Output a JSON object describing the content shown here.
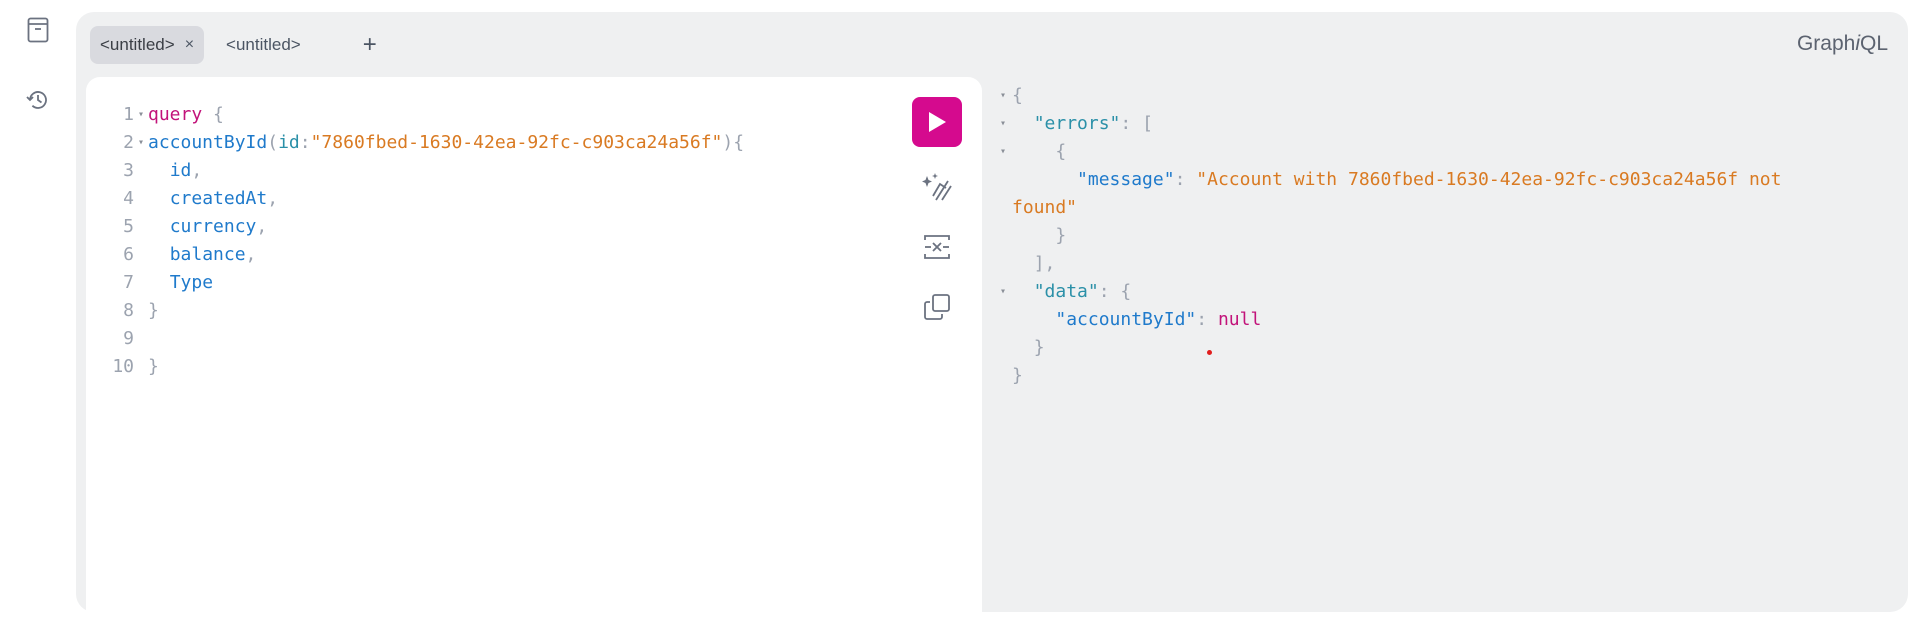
{
  "app": {
    "logo_prefix": "Graph",
    "logo_italic": "i",
    "logo_suffix": "QL"
  },
  "tabs": [
    {
      "label": "<untitled>",
      "close": "×"
    },
    {
      "label": "<untitled>"
    }
  ],
  "tab_add": "+",
  "icons": {
    "docs": "docs-icon",
    "history": "history-icon",
    "run": "play-icon",
    "prettify": "prettify-icon",
    "merge": "merge-fragments-icon",
    "copy": "copy-icon"
  },
  "colors": {
    "accent": "#d50a8e",
    "keyword": "#c2137a",
    "field": "#1f7acb",
    "string": "#d97a22",
    "key": "#2b90a8"
  },
  "query": {
    "line_numbers": [
      "1",
      "2",
      "3",
      "4",
      "5",
      "6",
      "7",
      "8",
      "9",
      "10"
    ],
    "l1": {
      "kw": "query",
      "brace": " {"
    },
    "l2": {
      "fn": "accountById",
      "open": "(",
      "arg": "id",
      "colon": ":",
      "str": "\"7860fbed-1630-42ea-92fc-c903ca24a56f\"",
      "close": "){"
    },
    "fields": [
      "id",
      "createdAt",
      "currency",
      "balance",
      "Type"
    ],
    "comma": ",",
    "close_inner": "}",
    "close_outer": "}"
  },
  "response": {
    "open": "{",
    "errors_key": "\"errors\"",
    "colon": ": ",
    "bracket_open": "[",
    "obj_open": "{",
    "message_key": "\"message\"",
    "message_value_1": "\"Account with 7860fbed-1630-42ea-92fc-c903ca24a56f not",
    "message_value_2": "found\"",
    "obj_close": "}",
    "bracket_close": "],",
    "data_key": "\"data\"",
    "data_open": "{",
    "account_key": "\"accountById\"",
    "account_value": "null",
    "data_close": "}",
    "close": "}"
  }
}
